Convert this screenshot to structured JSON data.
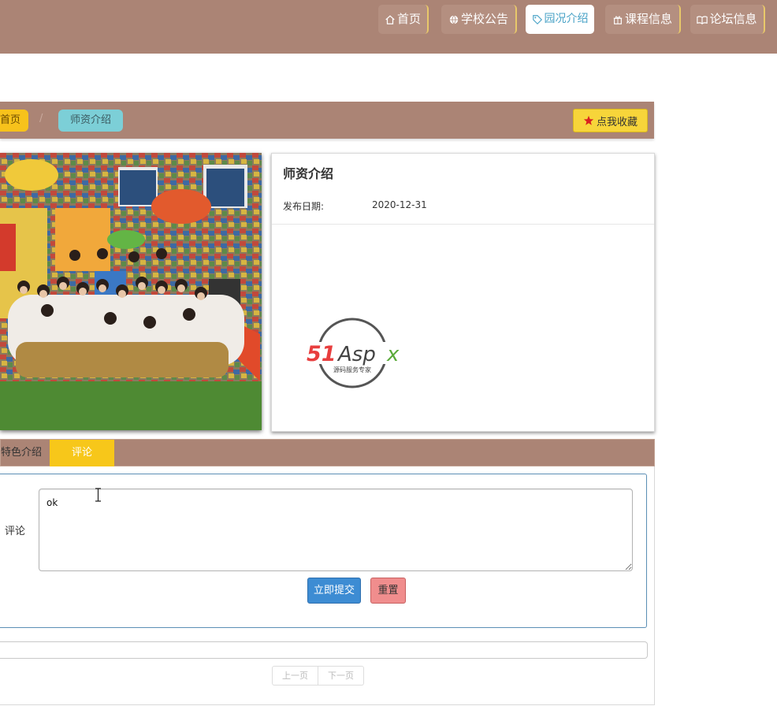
{
  "nav": {
    "items": [
      {
        "label": "首页",
        "icon": "home-icon"
      },
      {
        "label": "学校公告",
        "icon": "globe-icon"
      },
      {
        "label": "园况介绍",
        "icon": "tag-icon",
        "active": true
      },
      {
        "label": "课程信息",
        "icon": "gift-icon"
      },
      {
        "label": "论坛信息",
        "icon": "book-icon"
      }
    ]
  },
  "breadcrumb": {
    "home": "首页",
    "separator": "/",
    "current": "师资介绍"
  },
  "favorite_label": "点我收藏",
  "article": {
    "title": "师资介绍",
    "date_label": "发布日期:",
    "date": "2020-12-31"
  },
  "logo": {
    "brand": "51Aspx",
    "tagline": "源码服务专家"
  },
  "tabs": {
    "intro": "特色介绍",
    "comment": "评论"
  },
  "comment_form": {
    "label": "评论",
    "value": "ok",
    "submit_label": "立即提交",
    "reset_label": "重置"
  },
  "pager": {
    "prev": "上一页",
    "next": "下一页"
  },
  "colors": {
    "nav_bg": "#ab8475",
    "accent_yellow": "#f7c71a",
    "accent_teal": "#7ccfd7",
    "submit": "#3d8cd3",
    "reset": "#f08d8d"
  }
}
